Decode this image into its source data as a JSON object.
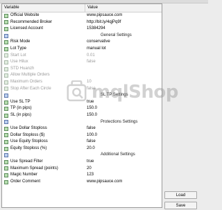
{
  "header": {
    "variable": "Variable",
    "value": "Value"
  },
  "rows": [
    {
      "type": "param",
      "icon": "green",
      "label": "Official Website",
      "value": "www.pipsauce.com"
    },
    {
      "type": "param",
      "icon": "green",
      "label": "Recommended Broker",
      "value": "http://bit.ly/4qjPq9f"
    },
    {
      "type": "param",
      "icon": "green",
      "label": "Licensed Account",
      "value": "15384294"
    },
    {
      "type": "sep",
      "icon": "blue",
      "label": "",
      "value": "General Settings"
    },
    {
      "type": "param",
      "icon": "green",
      "label": "Risk Mode",
      "value": "conservative"
    },
    {
      "type": "param",
      "icon": "green",
      "label": "Lot Type",
      "value": "manual lot"
    },
    {
      "type": "param",
      "icon": "dim",
      "label": "Start Lot",
      "value": "0.01",
      "dim": true
    },
    {
      "type": "param",
      "icon": "dim",
      "label": "Use Hilux",
      "value": "false",
      "dim": true
    },
    {
      "type": "param",
      "icon": "dim",
      "label": "STD Huanzh",
      "value": "",
      "dim": true
    },
    {
      "type": "param",
      "icon": "dim",
      "label": "Allow Multiple Orders",
      "value": "",
      "dim": true
    },
    {
      "type": "param",
      "icon": "dim",
      "label": "Maximum Orders",
      "value": "10",
      "dim": true
    },
    {
      "type": "param",
      "icon": "dim",
      "label": "Stop After Each Circle",
      "value": "false",
      "dim": true
    },
    {
      "type": "sep",
      "icon": "blue",
      "label": "",
      "value": "SL TP Settings"
    },
    {
      "type": "param",
      "icon": "green",
      "label": "Use SL TP",
      "value": "true"
    },
    {
      "type": "param",
      "icon": "green",
      "label": "TP (in pips)",
      "value": "150.0"
    },
    {
      "type": "param",
      "icon": "green",
      "label": "SL (in pips)",
      "value": "150.0"
    },
    {
      "type": "sep",
      "icon": "blue",
      "label": "",
      "value": "Protections Settings"
    },
    {
      "type": "param",
      "icon": "green",
      "label": "Use Dollar Stoploss",
      "value": "false"
    },
    {
      "type": "param",
      "icon": "green",
      "label": "Dollar Stoploss ($)",
      "value": "100.0"
    },
    {
      "type": "param",
      "icon": "green",
      "label": "Use Equity Stoploss",
      "value": "false"
    },
    {
      "type": "param",
      "icon": "green",
      "label": "Equity Stoploss (%)",
      "value": "20.0"
    },
    {
      "type": "sep",
      "icon": "blue",
      "label": "",
      "value": "Additional Settings"
    },
    {
      "type": "param",
      "icon": "green",
      "label": "Use Spread Filter",
      "value": "true"
    },
    {
      "type": "param",
      "icon": "green",
      "label": "Maximum Spread (points)",
      "value": "20"
    },
    {
      "type": "param",
      "icon": "green",
      "label": "Magic Number",
      "value": "123"
    },
    {
      "type": "param",
      "icon": "green",
      "label": "Order Comment",
      "value": "www.pipsauce.com"
    }
  ],
  "buttons": {
    "load": "Load",
    "save": "Save"
  },
  "watermark": {
    "text": "mqlShop"
  }
}
